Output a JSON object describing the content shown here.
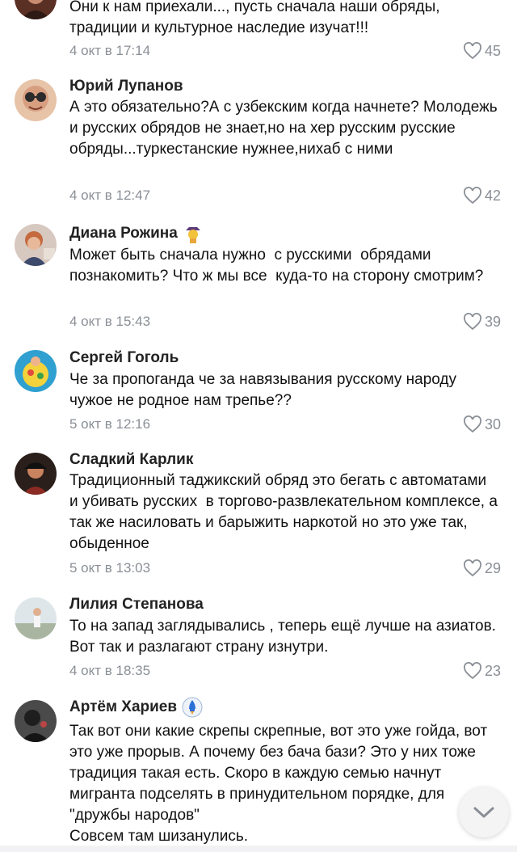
{
  "comments": [
    {
      "author": "",
      "text": "Они к нам приехали..., пусть сначала наши обряды, традиции и культурное наследие изучат!!!",
      "date": "4 окт в 17:14",
      "likes": "45",
      "avatar_color": "#6b3b2e"
    },
    {
      "author": "Юрий Лупанов",
      "text": "А это обязательно?А с узбекским когда начнете? Молодежь и русских обрядов не знает,но на хер русским русские обряды...туркестанские нужнее,нихаб с ними",
      "date": "4 окт в 12:47",
      "likes": "42",
      "avatar_color": "#d9a98a"
    },
    {
      "author": "Диана Рожина",
      "text": "Может быть сначала нужно  с русскими  обрядами познакомить? Что ж мы все  куда-то на сторону смотрим?",
      "date": "4 окт в 15:43",
      "likes": "39",
      "avatar_color": "#c47a5a"
    },
    {
      "author": "Сергей Гоголь",
      "text": "Че за пропоганда че за навязывания русскому народу чужое не родное нам трепье??",
      "date": "5 окт в 12:16",
      "likes": "30",
      "avatar_color": "#3aa0c8"
    },
    {
      "author": "Сладкий Карлик",
      "text": "Традиционный таджикский обряд это бегать с автоматами и убивать русских  в торгово-развлекательном комплексе, а так же насиловать и барыжить наркотой но это уже так, обыденное",
      "date": "5 окт в 13:03",
      "likes": "29",
      "avatar_color": "#3b2a22"
    },
    {
      "author": "Лилия Степанова",
      "text": "То на запад заглядывались , теперь ещё лучше на азиатов. Вот так и разлагают страну изнутри.",
      "date": "4 окт в 18:35",
      "likes": "23",
      "avatar_color": "#c9d3d9"
    },
    {
      "author": "Артём Хариев",
      "text": "Так вот они какие скрепы скрепные, вот это уже гойда, вот это уже прорыв. А почему без бача бази? Это у них тоже традиция такая есть. Скоро в каждую семью начнут мигранта подселять в принудительном порядке, для \"дружбы народов\"\nСовсем там шизанулись.",
      "date": "",
      "likes": "",
      "avatar_color": "#3c3c3c"
    }
  ],
  "icons": {
    "like": "heart-icon",
    "scroll": "chevron-down-icon"
  },
  "colors": {
    "meta": "#8a8f96",
    "text": "#111111"
  }
}
